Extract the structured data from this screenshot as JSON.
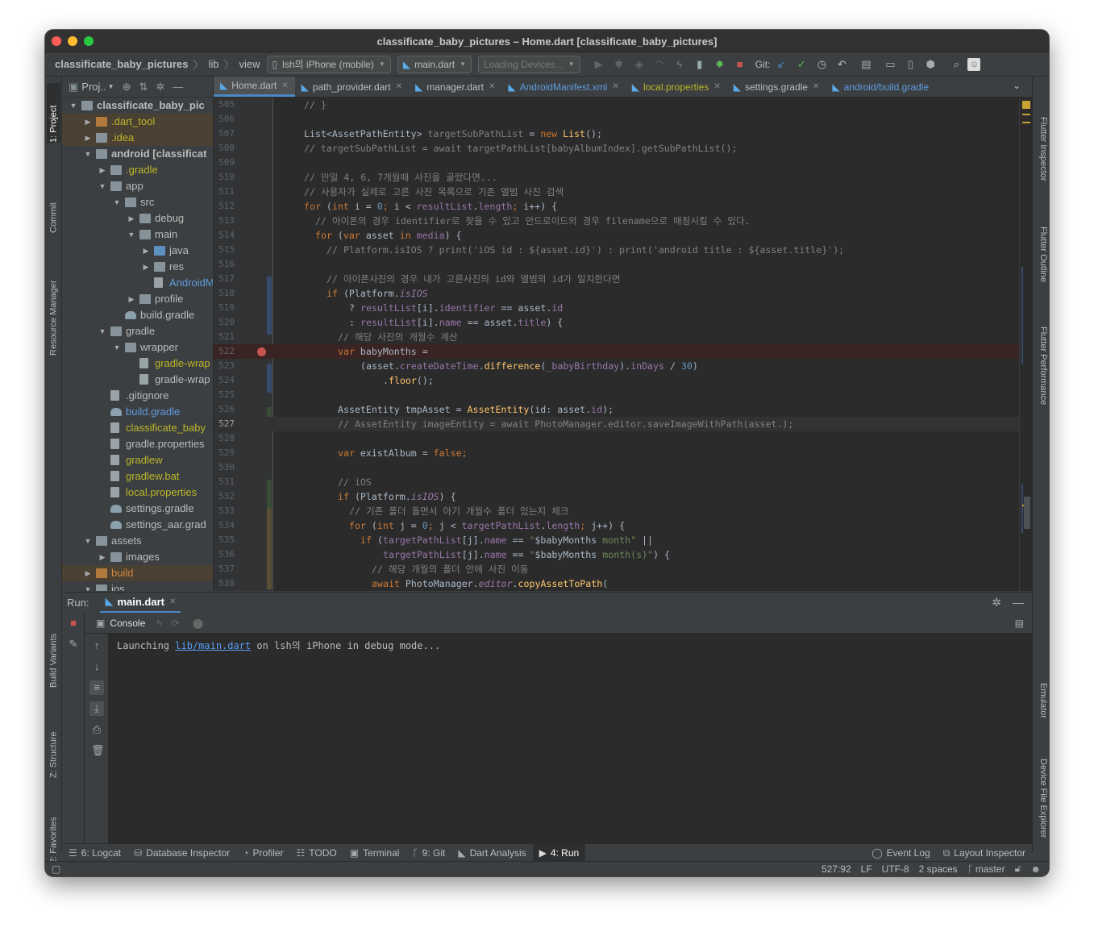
{
  "window": {
    "title": "classificate_baby_pictures – Home.dart [classificate_baby_pictures]"
  },
  "toolbar": {
    "crumbs": [
      "classificate_baby_pictures",
      "lib",
      "view"
    ],
    "device": "lsh의 iPhone (mobile)",
    "config": "main.dart",
    "loading_devices": "Loading Devices...",
    "git_label": "Git:"
  },
  "left_stripe": [
    "1: Project",
    "Commit",
    "Resource Manager",
    "Build Variants",
    "Z: Structure",
    "2: Favorites"
  ],
  "right_stripe": [
    "Flutter Inspector",
    "Flutter Outline",
    "Flutter Performance",
    "Emulator",
    "Device File Explorer"
  ],
  "project": {
    "header": "Proj..",
    "tree": [
      {
        "name": "classificate_baby_pic",
        "depth": 0,
        "arrow": "open",
        "icon": "folder",
        "style": "bold"
      },
      {
        "name": ".dart_tool",
        "depth": 1,
        "arrow": "closed",
        "icon": "folder-orange",
        "style": "excluded"
      },
      {
        "name": ".idea",
        "depth": 1,
        "arrow": "closed",
        "icon": "folder",
        "style": "excluded"
      },
      {
        "name": "android [classificat",
        "depth": 1,
        "arrow": "open",
        "icon": "folder",
        "style": "bold"
      },
      {
        "name": ".gradle",
        "depth": 2,
        "arrow": "closed",
        "icon": "folder",
        "style": "yellow"
      },
      {
        "name": "app",
        "depth": 2,
        "arrow": "open",
        "icon": "folder",
        "style": "normal"
      },
      {
        "name": "src",
        "depth": 3,
        "arrow": "open",
        "icon": "folder",
        "style": "normal"
      },
      {
        "name": "debug",
        "depth": 4,
        "arrow": "closed",
        "icon": "folder",
        "style": "normal"
      },
      {
        "name": "main",
        "depth": 4,
        "arrow": "open",
        "icon": "folder",
        "style": "normal"
      },
      {
        "name": "java",
        "depth": 5,
        "arrow": "closed",
        "icon": "folder-blue",
        "style": "normal"
      },
      {
        "name": "res",
        "depth": 5,
        "arrow": "closed",
        "icon": "folder",
        "style": "normal"
      },
      {
        "name": "AndroidM",
        "depth": 5,
        "arrow": "none",
        "icon": "file",
        "style": "blue"
      },
      {
        "name": "profile",
        "depth": 4,
        "arrow": "closed",
        "icon": "folder",
        "style": "normal"
      },
      {
        "name": "build.gradle",
        "depth": 3,
        "arrow": "none",
        "icon": "gradle",
        "style": "normal"
      },
      {
        "name": "gradle",
        "depth": 2,
        "arrow": "open",
        "icon": "folder",
        "style": "normal"
      },
      {
        "name": "wrapper",
        "depth": 3,
        "arrow": "open",
        "icon": "folder",
        "style": "normal"
      },
      {
        "name": "gradle-wrap",
        "depth": 4,
        "arrow": "none",
        "icon": "file",
        "style": "yellow"
      },
      {
        "name": "gradle-wrap",
        "depth": 4,
        "arrow": "none",
        "icon": "file",
        "style": "normal"
      },
      {
        "name": ".gitignore",
        "depth": 2,
        "arrow": "none",
        "icon": "file",
        "style": "normal"
      },
      {
        "name": "build.gradle",
        "depth": 2,
        "arrow": "none",
        "icon": "gradle",
        "style": "blue"
      },
      {
        "name": "classificate_baby",
        "depth": 2,
        "arrow": "none",
        "icon": "file",
        "style": "yellow"
      },
      {
        "name": "gradle.properties",
        "depth": 2,
        "arrow": "none",
        "icon": "file",
        "style": "normal"
      },
      {
        "name": "gradlew",
        "depth": 2,
        "arrow": "none",
        "icon": "file",
        "style": "yellow"
      },
      {
        "name": "gradlew.bat",
        "depth": 2,
        "arrow": "none",
        "icon": "file",
        "style": "yellow"
      },
      {
        "name": "local.properties",
        "depth": 2,
        "arrow": "none",
        "icon": "file",
        "style": "yellow"
      },
      {
        "name": "settings.gradle",
        "depth": 2,
        "arrow": "none",
        "icon": "gradle",
        "style": "normal"
      },
      {
        "name": "settings_aar.grad",
        "depth": 2,
        "arrow": "none",
        "icon": "gradle",
        "style": "normal"
      },
      {
        "name": "assets",
        "depth": 1,
        "arrow": "open",
        "icon": "folder",
        "style": "normal"
      },
      {
        "name": "images",
        "depth": 2,
        "arrow": "closed",
        "icon": "folder",
        "style": "normal"
      },
      {
        "name": "build",
        "depth": 1,
        "arrow": "closed",
        "icon": "folder-orange",
        "style": "excluded-orange"
      },
      {
        "name": "ios",
        "depth": 1,
        "arrow": "open",
        "icon": "folder",
        "style": "normal"
      }
    ]
  },
  "editor_tabs": [
    {
      "label": "Home.dart",
      "active": true,
      "color": "normal",
      "closable": true
    },
    {
      "label": "path_provider.dart",
      "active": false,
      "color": "normal",
      "closable": true
    },
    {
      "label": "manager.dart",
      "active": false,
      "color": "normal",
      "closable": true
    },
    {
      "label": "AndroidManifest.xml",
      "active": false,
      "color": "blue",
      "closable": true
    },
    {
      "label": "local.properties",
      "active": false,
      "color": "yellow",
      "closable": true
    },
    {
      "label": "settings.gradle",
      "active": false,
      "color": "normal",
      "closable": true
    },
    {
      "label": "android/build.gradle",
      "active": false,
      "color": "blue",
      "closable": false
    }
  ],
  "code": {
    "current_line": 527,
    "breakpoint_line": 522,
    "lines": [
      {
        "n": "505",
        "ind": 0,
        "tokens": [
          [
            "cm",
            "// }"
          ]
        ]
      },
      {
        "n": "506",
        "ind": 0,
        "tokens": []
      },
      {
        "n": "507",
        "ind": 0,
        "tokens": [
          [
            "",
            "List<AssetPathEntity> "
          ],
          [
            "cmg",
            "targetSubPathList"
          ],
          [
            "",
            " = "
          ],
          [
            "kw",
            "new "
          ],
          [
            "fn",
            "List"
          ],
          [
            "",
            "();"
          ]
        ]
      },
      {
        "n": "508",
        "ind": 0,
        "tokens": [
          [
            "cm",
            "// targetSubPathList = await targetPathList[babyAlbumIndex].getSubPathList();"
          ]
        ]
      },
      {
        "n": "509",
        "ind": 0,
        "tokens": []
      },
      {
        "n": "510",
        "ind": 0,
        "tokens": [
          [
            "cm",
            "// 만일 4, 6, 7개월때 사진을 골랐다면..."
          ]
        ]
      },
      {
        "n": "511",
        "ind": 0,
        "tokens": [
          [
            "cm",
            "// 사용자가 실제로 고른 사진 목록으로 기존 앨범 사진 검색"
          ]
        ]
      },
      {
        "n": "512",
        "ind": 0,
        "tokens": [
          [
            "kw",
            "for "
          ],
          [
            "",
            "("
          ],
          [
            "kw",
            "int "
          ],
          [
            "",
            "i = "
          ],
          [
            "nm",
            "0"
          ],
          [
            "kw",
            "; "
          ],
          [
            "",
            "i < "
          ],
          [
            "fl",
            "resultList"
          ],
          [
            "",
            "."
          ],
          [
            "fl",
            "length"
          ],
          [
            "kw",
            "; "
          ],
          [
            "",
            "i++) {"
          ]
        ]
      },
      {
        "n": "513",
        "ind": 1,
        "tokens": [
          [
            "cm",
            "// 아이폰의 경우 identifier로 찾을 수 있고 안드로이드의 경우 filename으로 매칭시킬 수 있다."
          ]
        ]
      },
      {
        "n": "514",
        "ind": 1,
        "tokens": [
          [
            "kw",
            "for "
          ],
          [
            "",
            "("
          ],
          [
            "kw",
            "var "
          ],
          [
            "",
            "asset "
          ],
          [
            "kw",
            "in "
          ],
          [
            "fl",
            "media"
          ],
          [
            "",
            ") {"
          ]
        ]
      },
      {
        "n": "515",
        "ind": 2,
        "tokens": [
          [
            "cm",
            "// Platform.isIOS ? print('iOS id : ${asset.id}') : print('android title : ${asset.title}');"
          ]
        ]
      },
      {
        "n": "516",
        "ind": 0,
        "tokens": []
      },
      {
        "n": "517",
        "ind": 2,
        "tokens": [
          [
            "cm",
            "// 아이폰사진의 경우 내가 고른사진의 id와 앨범의 id가 일치한다면"
          ]
        ]
      },
      {
        "n": "518",
        "ind": 2,
        "tokens": [
          [
            "kw",
            "if "
          ],
          [
            "",
            "(Platform."
          ],
          [
            "fli",
            "isIOS"
          ]
        ]
      },
      {
        "n": "519",
        "ind": 4,
        "tokens": [
          [
            "",
            "? "
          ],
          [
            "fl",
            "resultList"
          ],
          [
            "",
            "[i]."
          ],
          [
            "fl",
            "identifier"
          ],
          [
            "",
            " == asset."
          ],
          [
            "fl",
            "id"
          ]
        ]
      },
      {
        "n": "520",
        "ind": 4,
        "tokens": [
          [
            "",
            ": "
          ],
          [
            "fl",
            "resultList"
          ],
          [
            "",
            "[i]."
          ],
          [
            "fl",
            "name"
          ],
          [
            "",
            " == asset."
          ],
          [
            "fl",
            "title"
          ],
          [
            "",
            ") {"
          ]
        ]
      },
      {
        "n": "521",
        "ind": 3,
        "tokens": [
          [
            "cm",
            "// 해당 사진의 개월수 계산"
          ]
        ]
      },
      {
        "n": "522",
        "ind": 3,
        "tokens": [
          [
            "kw",
            "var "
          ],
          [
            "",
            "babyMonths ="
          ]
        ]
      },
      {
        "n": "523",
        "ind": 5,
        "tokens": [
          [
            "",
            "(asset."
          ],
          [
            "fl",
            "createDateTime"
          ],
          [
            "",
            "."
          ],
          [
            "fn2",
            "difference"
          ],
          [
            "",
            "("
          ],
          [
            "fl",
            "_babyBirthday"
          ],
          [
            "",
            ")."
          ],
          [
            "fl",
            "inDays"
          ],
          [
            "",
            " / "
          ],
          [
            "nm",
            "30"
          ],
          [
            "",
            ")"
          ]
        ]
      },
      {
        "n": "524",
        "ind": 7,
        "tokens": [
          [
            "",
            "."
          ],
          [
            "fn2",
            "floor"
          ],
          [
            "",
            "();"
          ]
        ]
      },
      {
        "n": "525",
        "ind": 0,
        "tokens": []
      },
      {
        "n": "526",
        "ind": 3,
        "tokens": [
          [
            "",
            "AssetEntity tmpAsset = "
          ],
          [
            "fn",
            "AssetEntity"
          ],
          [
            "",
            "(id: asset."
          ],
          [
            "fl",
            "id"
          ],
          [
            "",
            ");"
          ]
        ]
      },
      {
        "n": "527",
        "ind": 3,
        "tokens": [
          [
            "cm",
            "// AssetEntity imageEntity = await PhotoManager.editor.saveImageWithPath(asset.);"
          ]
        ]
      },
      {
        "n": "528",
        "ind": 0,
        "tokens": []
      },
      {
        "n": "529",
        "ind": 3,
        "tokens": [
          [
            "kw",
            "var "
          ],
          [
            "",
            "existAlbum = "
          ],
          [
            "kw",
            "false"
          ],
          [
            "kw",
            ";"
          ]
        ]
      },
      {
        "n": "530",
        "ind": 0,
        "tokens": []
      },
      {
        "n": "531",
        "ind": 3,
        "tokens": [
          [
            "cm",
            "// iOS"
          ]
        ]
      },
      {
        "n": "532",
        "ind": 3,
        "tokens": [
          [
            "kw",
            "if "
          ],
          [
            "",
            "(Platform."
          ],
          [
            "fli",
            "isIOS"
          ],
          [
            "",
            ") {"
          ]
        ]
      },
      {
        "n": "533",
        "ind": 4,
        "tokens": [
          [
            "cm",
            "// 기존 폴더 돌면서 아기 개월수 폴더 있는지 체크"
          ]
        ]
      },
      {
        "n": "534",
        "ind": 4,
        "tokens": [
          [
            "kw",
            "for "
          ],
          [
            "",
            "("
          ],
          [
            "kw",
            "int "
          ],
          [
            "",
            "j = "
          ],
          [
            "nm",
            "0"
          ],
          [
            "kw",
            "; "
          ],
          [
            "",
            "j < "
          ],
          [
            "fl",
            "targetPathList"
          ],
          [
            "",
            "."
          ],
          [
            "fl",
            "length"
          ],
          [
            "kw",
            "; "
          ],
          [
            "",
            "j++) {"
          ]
        ]
      },
      {
        "n": "535",
        "ind": 5,
        "tokens": [
          [
            "kw",
            "if "
          ],
          [
            "",
            "("
          ],
          [
            "fl",
            "targetPathList"
          ],
          [
            "",
            "[j]."
          ],
          [
            "fl",
            "name"
          ],
          [
            "",
            " == "
          ],
          [
            "st",
            "\""
          ],
          [
            "",
            "$babyMonths"
          ],
          [
            "st",
            " month\""
          ],
          [
            "",
            " ||"
          ]
        ]
      },
      {
        "n": "536",
        "ind": 7,
        "tokens": [
          [
            "fl",
            "targetPathList"
          ],
          [
            "",
            "[j]."
          ],
          [
            "fl",
            "name"
          ],
          [
            "",
            " == "
          ],
          [
            "st",
            "\""
          ],
          [
            "",
            "$babyMonths"
          ],
          [
            "st",
            " month(s)\""
          ],
          [
            "",
            ") {"
          ]
        ]
      },
      {
        "n": "537",
        "ind": 6,
        "tokens": [
          [
            "cm",
            "// 해당 개월의 폴더 안에 사진 이동"
          ]
        ]
      },
      {
        "n": "538",
        "ind": 6,
        "tokens": [
          [
            "kw",
            "await "
          ],
          [
            "",
            "PhotoManager."
          ],
          [
            "fli",
            "editor"
          ],
          [
            "",
            "."
          ],
          [
            "fn2",
            "copyAssetToPath"
          ],
          [
            "",
            "("
          ]
        ]
      }
    ]
  },
  "run": {
    "label": "Run:",
    "tab": "main.dart",
    "console_tab": "Console",
    "output_prefix": "Launching ",
    "output_link": "lib/main.dart",
    "output_suffix": " on lsh의 iPhone in debug mode..."
  },
  "bottom_bar": {
    "items": [
      "6: Logcat",
      "Database Inspector",
      "Profiler",
      "TODO",
      "Terminal",
      "9: Git",
      "Dart Analysis",
      "4: Run"
    ],
    "right": [
      "Event Log",
      "Layout Inspector"
    ]
  },
  "status": {
    "position": "527:92",
    "line_sep": "LF",
    "encoding": "UTF-8",
    "indent": "2 spaces",
    "branch": "master"
  }
}
